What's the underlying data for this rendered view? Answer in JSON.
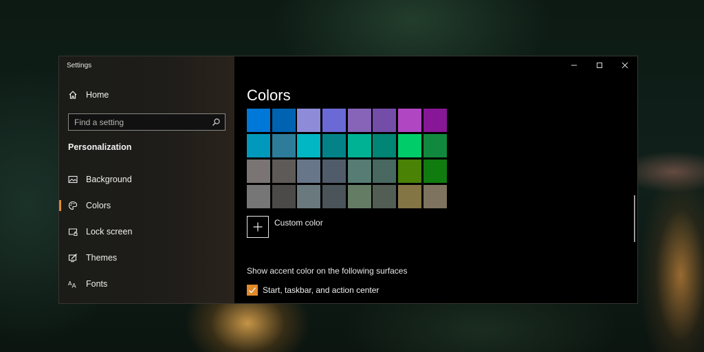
{
  "window": {
    "title": "Settings",
    "controls": [
      "minimize",
      "maximize",
      "close"
    ]
  },
  "sidebar": {
    "home_label": "Home",
    "search": {
      "placeholder": "Find a setting",
      "value": ""
    },
    "section_heading": "Personalization",
    "items": [
      {
        "label": "Background",
        "icon": "picture-icon",
        "selected": false
      },
      {
        "label": "Colors",
        "icon": "palette-icon",
        "selected": true
      },
      {
        "label": "Lock screen",
        "icon": "lock-screen-icon",
        "selected": false
      },
      {
        "label": "Themes",
        "icon": "themes-icon",
        "selected": false
      },
      {
        "label": "Fonts",
        "icon": "fonts-icon",
        "selected": false
      }
    ]
  },
  "main": {
    "title": "Colors",
    "swatches": [
      "#0078D7",
      "#0063B1",
      "#8E8CD8",
      "#6B69D6",
      "#8764B8",
      "#744DA9",
      "#B146C2",
      "#881798",
      "#0099BC",
      "#2D7D9A",
      "#00B7C3",
      "#038387",
      "#00B294",
      "#018574",
      "#00CC6A",
      "#10893E",
      "#7A7574",
      "#5D5A58",
      "#68768A",
      "#515C6B",
      "#567C73",
      "#486860",
      "#498205",
      "#107C10",
      "#767676",
      "#4C4A48",
      "#69797E",
      "#4A5459",
      "#647C64",
      "#525E54",
      "#847545",
      "#7E735F"
    ],
    "custom_color_label": "Custom color",
    "surfaces_label": "Show accent color on the following surfaces",
    "checkbox": {
      "label": "Start, taskbar, and action center",
      "checked": true
    }
  },
  "colors": {
    "accent": "#E08A2C"
  }
}
